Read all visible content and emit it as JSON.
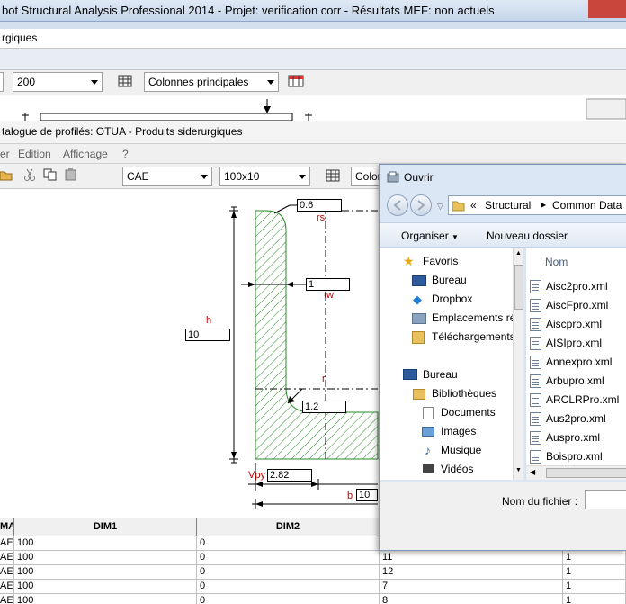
{
  "main_window": {
    "title": "bot Structural Analysis Professional 2014 - Projet: verification corr - Résultats MEF: non actuels",
    "subtitle_bar": "rgiques"
  },
  "main_toolbar": {
    "size_combo": "200",
    "columns_combo": "Colonnes principales"
  },
  "catalog_window": {
    "title": "talogue de profilés: OTUA - Produits siderurgiques",
    "menu": [
      "er",
      "Edition",
      "Affichage",
      "?"
    ],
    "family_combo": "CAE",
    "profile_combo": "100x10",
    "columns_button": "Colon"
  },
  "drawing": {
    "rs_label": "rs",
    "rs_value": "0.6",
    "tw_label": "tw",
    "tw_value": "1",
    "h_label": "h",
    "h_value": "10",
    "r_label": "r",
    "r_value": "1.2",
    "vpy_label": "Vpy",
    "vpy_value": "2.82",
    "b_label": "b",
    "b_value": "10"
  },
  "table": {
    "headers": [
      "MA",
      "DIM1",
      "DIM2"
    ],
    "rows": [
      {
        "ma": "AE",
        "dim1": "100",
        "dim2": "0",
        "c4": "",
        "c5": "1"
      },
      {
        "ma": "AE",
        "dim1": "100",
        "dim2": "0",
        "c4": "11",
        "c5": "1"
      },
      {
        "ma": "AE",
        "dim1": "100",
        "dim2": "0",
        "c4": "12",
        "c5": "1"
      },
      {
        "ma": "AE",
        "dim1": "100",
        "dim2": "0",
        "c4": "7",
        "c5": "1"
      },
      {
        "ma": "AE",
        "dim1": "100",
        "dim2": "0",
        "c4": "8",
        "c5": "1"
      }
    ]
  },
  "open_dialog": {
    "title": "Ouvrir",
    "path": [
      "«",
      "Structural",
      "Common Data"
    ],
    "organize": "Organiser",
    "new_folder": "Nouveau dossier",
    "column_name": "Nom",
    "filename_label": "Nom du fichier :",
    "nav": {
      "favorites": "Favoris",
      "fav_items": [
        "Bureau",
        "Dropbox",
        "Emplacements ré",
        "Téléchargements"
      ],
      "desktop": "Bureau",
      "libraries": "Bibliothèques",
      "lib_items": [
        "Documents",
        "Images",
        "Musique",
        "Vidéos"
      ]
    },
    "files": [
      "Aisc2pro.xml",
      "AiscFpro.xml",
      "Aiscpro.xml",
      "AISIpro.xml",
      "Annexpro.xml",
      "Arbupro.xml",
      "ARCLRPro.xml",
      "Aus2pro.xml",
      "Auspro.xml",
      "Boispro.xml"
    ]
  },
  "colors": {
    "hatch": "#2a8a2a",
    "dim_red": "#c00000",
    "dialog_blue": "#dbe7f5"
  }
}
